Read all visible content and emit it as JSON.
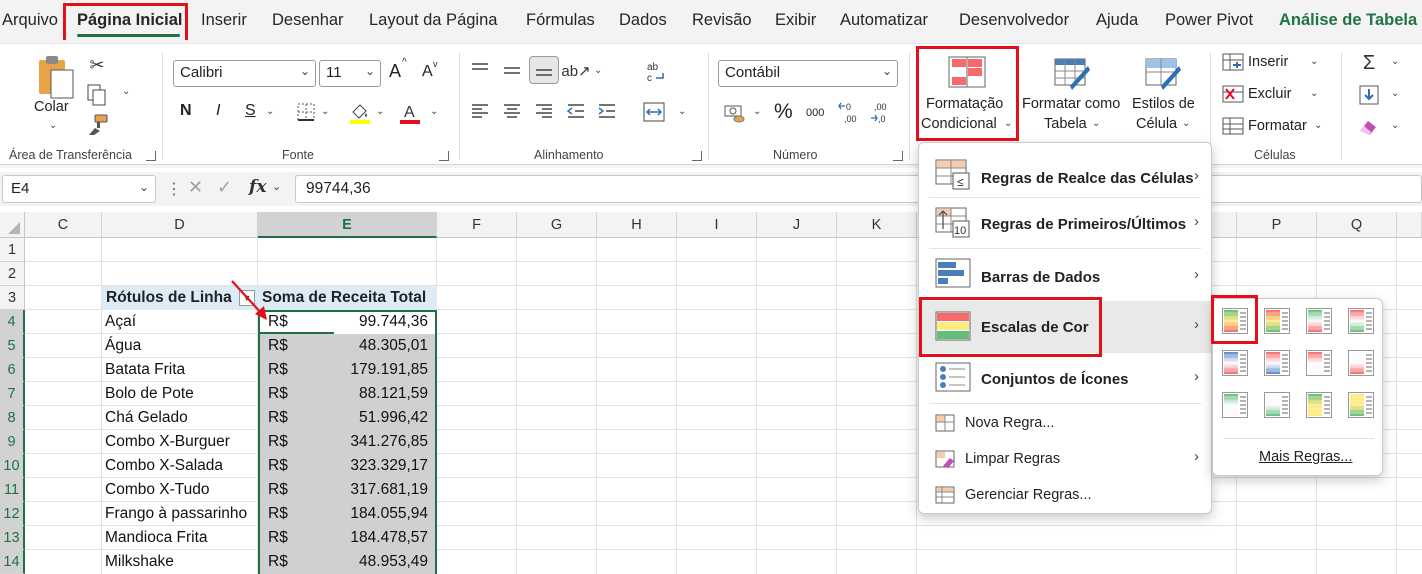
{
  "menu_tabs": [
    "Arquivo",
    "Página Inicial",
    "Inserir",
    "Desenhar",
    "Layout da Página",
    "Fórmulas",
    "Dados",
    "Revisão",
    "Exibir",
    "Automatizar",
    "Desenvolvedor",
    "Ajuda",
    "Power Pivot",
    "Análise de Tabela D"
  ],
  "ribbon": {
    "clipboard": {
      "paste_label": "Colar",
      "group_label": "Área de Transferência"
    },
    "font": {
      "font_name": "Calibri",
      "font_size": "11",
      "bold": "N",
      "italic": "I",
      "underline": "S",
      "grow": "A",
      "shrink": "A",
      "group_label": "Fonte"
    },
    "alignment": {
      "group_label": "Alinhamento"
    },
    "number": {
      "format": "Contábil",
      "percent": "%",
      "thousands": "000",
      "group_label": "Número"
    },
    "styles": {
      "conditional_line1": "Formatação",
      "conditional_line2": "Condicional",
      "table_line1": "Formatar como",
      "table_line2": "Tabela",
      "cell_line1": "Estilos de",
      "cell_line2": "Célula"
    },
    "cells": {
      "insert": "Inserir",
      "delete": "Excluir",
      "format": "Formatar",
      "group_label": "Células"
    }
  },
  "formula_bar": {
    "name_box": "E4",
    "fx": "fx",
    "value": "99744,36"
  },
  "columns": [
    "C",
    "D",
    "E",
    "F",
    "G",
    "H",
    "I",
    "J",
    "K",
    "P",
    "Q"
  ],
  "rows": [
    "1",
    "2",
    "3",
    "4",
    "5",
    "6",
    "7",
    "8",
    "9",
    "10",
    "11",
    "12",
    "13",
    "14"
  ],
  "pivot": {
    "header_labels": "Rótulos de Linha",
    "header_values": "Soma de Receita Total",
    "currency": "R$",
    "items": [
      {
        "label": "Açaí",
        "value": "99.744,36"
      },
      {
        "label": "Água",
        "value": "48.305,01"
      },
      {
        "label": "Batata Frita",
        "value": "179.191,85"
      },
      {
        "label": "Bolo de Pote",
        "value": "88.121,59"
      },
      {
        "label": "Chá Gelado",
        "value": "51.996,42"
      },
      {
        "label": "Combo X-Burguer",
        "value": "341.276,85"
      },
      {
        "label": "Combo X-Salada",
        "value": "323.329,17"
      },
      {
        "label": "Combo X-Tudo",
        "value": "317.681,19"
      },
      {
        "label": "Frango à passarinho",
        "value": "184.055,94"
      },
      {
        "label": "Mandioca Frita",
        "value": "184.478,57"
      },
      {
        "label": "Milkshake",
        "value": "48.953,49"
      }
    ]
  },
  "cf_menu": {
    "highlight_rules": "Regras de Realce das Células",
    "top_bottom_rules": "Regras de Primeiros/Últimos",
    "data_bars": "Barras de Dados",
    "color_scales": "Escalas de Cor",
    "icon_sets": "Conjuntos de Ícones",
    "new_rule": "Nova Regra...",
    "clear_rules": "Limpar Regras",
    "manage_rules": "Gerenciar Regras..."
  },
  "color_scale_menu": {
    "more_rules": "Mais Regras...",
    "scales": [
      [
        "#63be7b",
        "#ffeb84",
        "#f8696b"
      ],
      [
        "#f8696b",
        "#ffeb84",
        "#63be7b"
      ],
      [
        "#63be7b",
        "#fcfcff",
        "#f8696b"
      ],
      [
        "#f8696b",
        "#fcfcff",
        "#63be7b"
      ],
      [
        "#5a8ac6",
        "#fcfcff",
        "#f8696b"
      ],
      [
        "#f8696b",
        "#fcfcff",
        "#5a8ac6"
      ],
      [
        "#f8696b",
        "#fcfcff",
        "#fcfcff"
      ],
      [
        "#fcfcff",
        "#fcfcff",
        "#f8696b"
      ],
      [
        "#63be7b",
        "#fcfcff",
        "#fcfcff"
      ],
      [
        "#fcfcff",
        "#fcfcff",
        "#63be7b"
      ],
      [
        "#63be7b",
        "#ffeb84",
        "#ffeb84"
      ],
      [
        "#ffeb84",
        "#ffeb84",
        "#63be7b"
      ]
    ]
  }
}
